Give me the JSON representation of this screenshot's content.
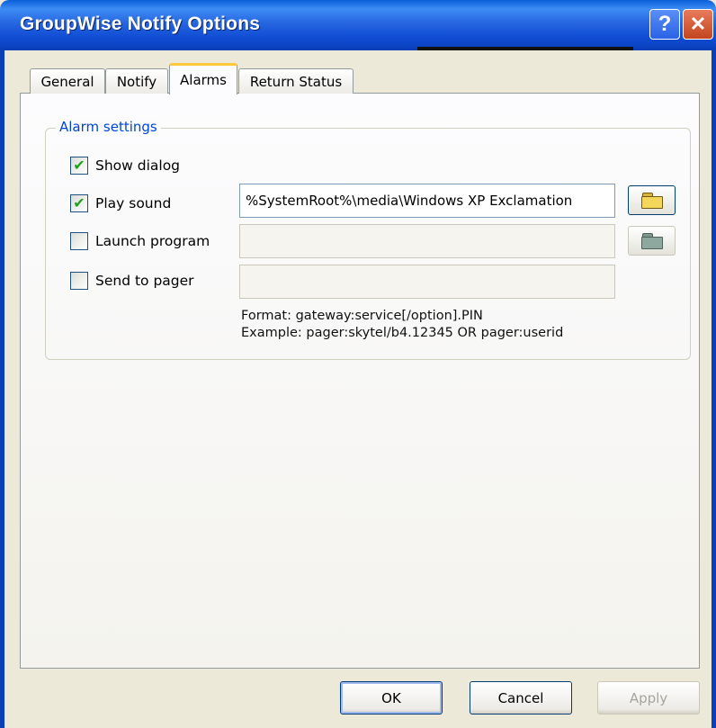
{
  "window": {
    "title": "GroupWise Notify Options"
  },
  "titlebar_buttons": {
    "help": "?",
    "close": "✕"
  },
  "tabs": [
    {
      "label": "General",
      "selected": false
    },
    {
      "label": "Notify",
      "selected": false
    },
    {
      "label": "Alarms",
      "selected": true
    },
    {
      "label": "Return Status",
      "selected": false
    }
  ],
  "alarm_settings": {
    "legend": "Alarm settings",
    "show_dialog": {
      "label": "Show dialog",
      "checked": true
    },
    "play_sound": {
      "label": "Play sound",
      "checked": true,
      "value": "%SystemRoot%\\media\\Windows XP Exclamation"
    },
    "launch_program": {
      "label": "Launch program",
      "checked": false,
      "value": ""
    },
    "send_to_pager": {
      "label": "Send to pager",
      "checked": false,
      "value": ""
    },
    "format_hint": "Format: gateway:service[/option].PIN",
    "example_hint": "Example: pager:skytel/b4.12345 OR pager:userid"
  },
  "buttons": {
    "ok": "OK",
    "cancel": "Cancel",
    "apply": "Apply"
  },
  "colors": {
    "title_bar": "#0a5fd8",
    "dialog_bg": "#ece9d8",
    "group_legend": "#0046d5",
    "check_mark": "#21a121",
    "folder_yellow": "#f3d65a",
    "folder_disabled": "#8fa89f"
  }
}
